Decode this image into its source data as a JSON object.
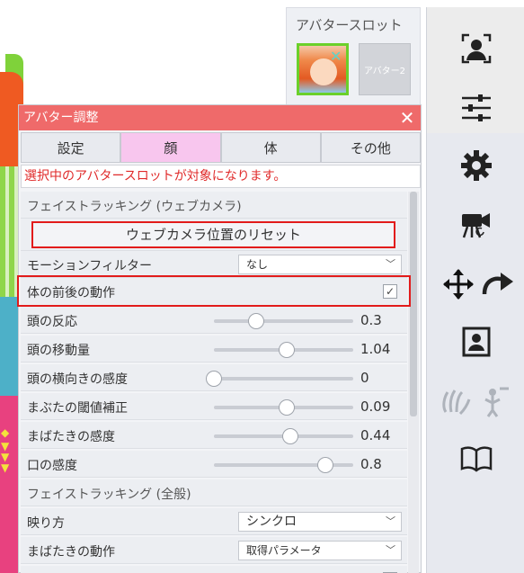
{
  "slot_panel": {
    "title": "アバタースロット",
    "slot2_label": "アバター2"
  },
  "panel": {
    "title": "アバター調整",
    "close_icon": "close-icon",
    "tabs": [
      "設定",
      "顔",
      "体",
      "その他"
    ],
    "active_tab": "顔",
    "notice": "選択中のアバタースロットが対象になります。",
    "sections": {
      "face_tracking_webcam": "フェイストラッキング (ウェブカメラ)",
      "face_tracking_general": "フェイストラッキング (全般)"
    },
    "reset_button": "ウェブカメラ位置のリセット",
    "motion_filter": {
      "label": "モーションフィルター",
      "value": "なし"
    },
    "body_motion": {
      "label": "体の前後の動作",
      "checked": true
    },
    "sliders": [
      {
        "label": "頭の反応",
        "value": "0.3",
        "fraction": 0.3
      },
      {
        "label": "頭の移動量",
        "value": "1.04",
        "fraction": 0.52
      },
      {
        "label": "頭の横向きの感度",
        "value": "0",
        "fraction": 0.0
      },
      {
        "label": "まぶたの閾値補正",
        "value": "0.09",
        "fraction": 0.52
      },
      {
        "label": "まばたきの感度",
        "value": "0.44",
        "fraction": 0.55
      },
      {
        "label": "口の感度",
        "value": "0.8",
        "fraction": 0.8
      }
    ],
    "reflection": {
      "label": "映り方",
      "value": "シンクロ"
    },
    "blink_motion": {
      "label": "まばたきの動作",
      "value": "取得パラメータ"
    }
  },
  "colors": {
    "header": "#ef6a6a",
    "active_tab": "#f8c6ee",
    "notice_text": "#e02a2a",
    "highlight": "#e21b1b",
    "slot_border": "#6bd02a"
  },
  "toolbar_icons": [
    "person-focus-icon",
    "sliders-icon",
    "gear-icon",
    "camera-icon",
    "move-arrows-icon",
    "rotate-arrow-icon",
    "portrait-icon",
    "gesture-icon",
    "book-icon"
  ]
}
